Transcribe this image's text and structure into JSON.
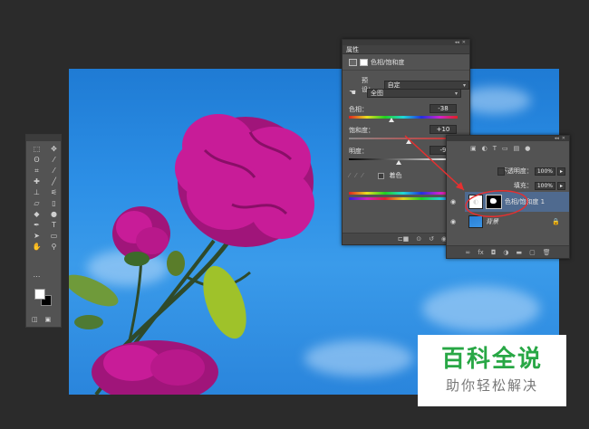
{
  "properties_panel": {
    "tab_label": "属性",
    "adjustment_title": "色相/饱和度",
    "preset_label": "预设：",
    "preset_value": "自定",
    "channel_value": "全图",
    "hue_label": "色相：",
    "hue_value": "-38",
    "hue_level": 0.395,
    "saturation_label": "饱和度：",
    "saturation_value": "+10",
    "saturation_level": 0.55,
    "lightness_label": "明度：",
    "lightness_value": "-9",
    "lightness_level": 0.455,
    "colorize_label": "着色"
  },
  "layers_panel": {
    "opacity_label": "不透明度：",
    "opacity_value": "100%",
    "fill_label": "填充：",
    "fill_value": "100%",
    "layers": [
      {
        "name": "色相/饱和度 1"
      },
      {
        "name": "背景"
      }
    ]
  },
  "watermark": {
    "title": "百科全说",
    "subtitle": "助你轻松解决"
  },
  "colors": {
    "app_background": "#2b2b2b",
    "panel": "#535353",
    "selected_layer": "#4f6a8f",
    "annotation_red": "#e53030",
    "watermark_green": "#28a745"
  }
}
